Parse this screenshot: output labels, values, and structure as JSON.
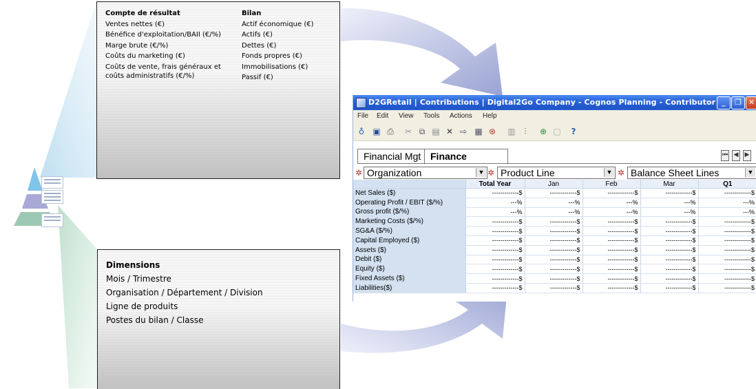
{
  "compte": {
    "title": "Compte de résultat",
    "items": [
      "Ventes nettes (€)",
      "Bénéfice d'exploitation/BAII (€/%)",
      "Marge brute (€/%)",
      "Coûts du marketing (€)",
      "Coûts de vente, frais généraux et",
      "coûts administratifs (€/%)"
    ]
  },
  "bilan": {
    "title": "Bilan",
    "items": [
      "Actif économique (€)",
      "Actifs (€)",
      "Dettes (€)",
      "Fonds propres (€)",
      "Immobilisations (€)",
      "Passif (€)"
    ]
  },
  "dimensions": {
    "title": "Dimensions",
    "items": [
      "Mois / Trimestre",
      "Organisation / Département / Division",
      "Ligne de produits",
      "Postes du bilan / Classe"
    ]
  },
  "window": {
    "title": "D2GRetail | Contributions | Digital2Go Company - Cognos Planning - Contributor",
    "menus": [
      "File",
      "Edit",
      "View",
      "Tools",
      "Actions",
      "Help"
    ],
    "tabs": [
      "Financial Mgt",
      "Finance"
    ],
    "selectors": [
      "Organization",
      "Product Line",
      "Balance Sheet Lines"
    ],
    "columns": [
      "Total Year",
      "Jan",
      "Feb",
      "Mar",
      "Q1"
    ],
    "rows": [
      {
        "label": "Net Sales ($)",
        "cells": [
          "-------------$",
          "-------------$",
          "-------------$",
          "-------------$",
          "-------------$"
        ]
      },
      {
        "label": "Operating Profit / EBIT ($/%)",
        "cells": [
          "---%",
          "---%",
          "---%",
          "---%",
          "---%"
        ]
      },
      {
        "label": "Gross profit ($/%)",
        "cells": [
          "---%",
          "---%",
          "---%",
          "---%",
          "---%"
        ]
      },
      {
        "label": "Marketing Costs ($/%)",
        "cells": [
          "-------------$",
          "-------------$",
          "-------------$",
          "-------------$",
          "-------------$"
        ]
      },
      {
        "label": "SG&A ($/%)",
        "cells": [
          "-------------$",
          "-------------$",
          "-------------$",
          "-------------$",
          "-------------$"
        ]
      },
      {
        "label": "Capital Employed ($)",
        "cells": [
          "-------------$",
          "-------------$",
          "-------------$",
          "-------------$",
          "-------------$"
        ]
      },
      {
        "label": "Assets ($)",
        "cells": [
          "-------------$",
          "-------------$",
          "-------------$",
          "-------------$",
          "-------------$"
        ]
      },
      {
        "label": "Debit ($)",
        "cells": [
          "-------------$",
          "-------------$",
          "-------------$",
          "-------------$",
          "-------------$"
        ]
      },
      {
        "label": "Equity ($)",
        "cells": [
          "-------------$",
          "-------------$",
          "-------------$",
          "-------------$",
          "-------------$"
        ]
      },
      {
        "label": "Fixed Assets ($)",
        "cells": [
          "-------------$",
          "-------------$",
          "-------------$",
          "-------------$",
          "-------------$"
        ]
      },
      {
        "label": "Liabilities($)",
        "cells": [
          "-------------$",
          "-------------$",
          "-------------$",
          "-------------$",
          "-------------$"
        ]
      }
    ]
  },
  "colors": {
    "titlebar": "#2a64d9",
    "row_label_bg": "#d3e1f1",
    "arrow": "#a9b0d8"
  }
}
